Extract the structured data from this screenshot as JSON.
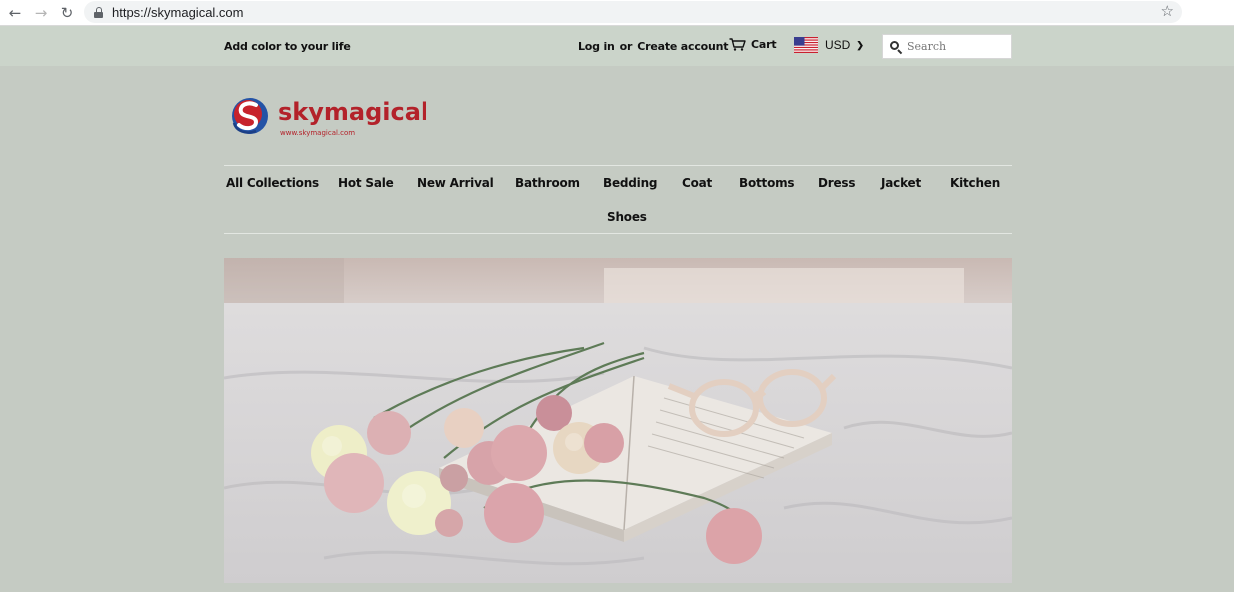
{
  "browser": {
    "url": "https://skymagical.com"
  },
  "topbar": {
    "tagline": "Add color to your life",
    "login": "Log in",
    "or": "or",
    "create_account": "Create account",
    "cart": "Cart",
    "currency": "USD",
    "search_placeholder": "Search"
  },
  "logo": {
    "name": "skymagical",
    "url_text": "www.skymagical.com",
    "colors": {
      "red": "#b3222a",
      "blue": "#2453a6"
    }
  },
  "nav": {
    "items": [
      "All Collections",
      "Hot Sale",
      "New Arrival",
      "Bathroom",
      "Bedding",
      "Coat",
      "Bottoms",
      "Dress",
      "Jacket",
      "Kitchen",
      "Shoes"
    ]
  },
  "hero": {
    "description_icon": "bed-flowers-book-glasses-photo"
  },
  "colors": {
    "page_bg": "#c5cbc3",
    "topbar_bg": "#cbd4ca",
    "text": "#111111"
  }
}
